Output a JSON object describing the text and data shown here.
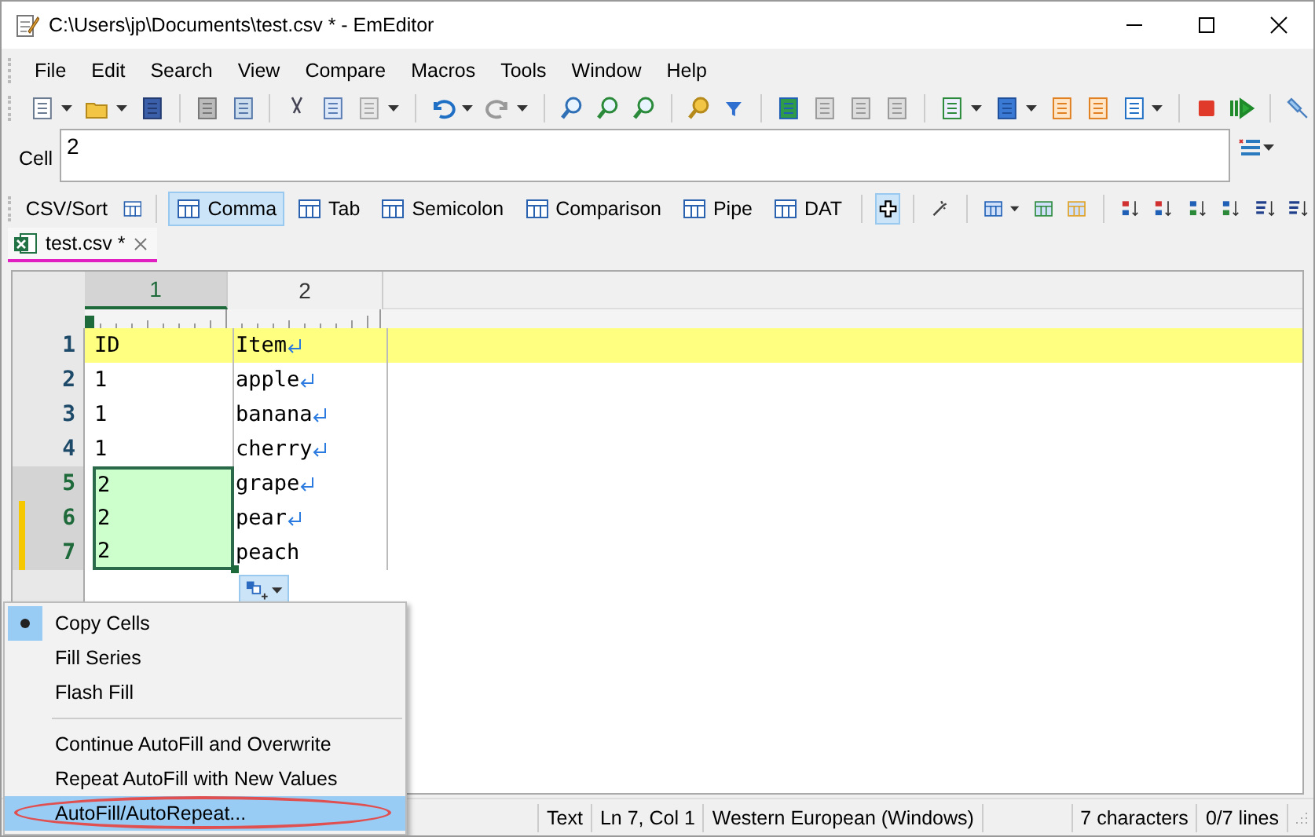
{
  "window": {
    "title": "C:\\Users\\jp\\Documents\\test.csv * - EmEditor"
  },
  "menu_bar": [
    "File",
    "Edit",
    "Search",
    "View",
    "Compare",
    "Macros",
    "Tools",
    "Window",
    "Help"
  ],
  "cell_bar": {
    "label": "Cell",
    "value": "2"
  },
  "csv_bar": {
    "label": "CSV/Sort",
    "formats": [
      {
        "label": "Comma",
        "selected": true
      },
      {
        "label": "Tab",
        "selected": false
      },
      {
        "label": "Semicolon",
        "selected": false
      },
      {
        "label": "Comparison",
        "selected": false
      },
      {
        "label": "Pipe",
        "selected": false
      },
      {
        "label": "DAT",
        "selected": false
      }
    ]
  },
  "tabs": [
    {
      "label": "test.csv *",
      "selected": true
    }
  ],
  "grid": {
    "columns": [
      {
        "label": "1",
        "selected": true
      },
      {
        "label": "2",
        "selected": false
      }
    ],
    "rows": [
      {
        "number": "1",
        "cells": [
          "ID",
          "Item"
        ],
        "header": true,
        "selected": false,
        "modified": false,
        "newline": true
      },
      {
        "number": "2",
        "cells": [
          "1",
          "apple"
        ],
        "header": false,
        "selected": false,
        "modified": false,
        "newline": true
      },
      {
        "number": "3",
        "cells": [
          "1",
          "banana"
        ],
        "header": false,
        "selected": false,
        "modified": false,
        "newline": true
      },
      {
        "number": "4",
        "cells": [
          "1",
          "cherry"
        ],
        "header": false,
        "selected": false,
        "modified": false,
        "newline": true
      },
      {
        "number": "5",
        "cells": [
          "2",
          "grape"
        ],
        "header": false,
        "selected": true,
        "modified": false,
        "newline": true
      },
      {
        "number": "6",
        "cells": [
          "2",
          "pear"
        ],
        "header": false,
        "selected": true,
        "modified": true,
        "newline": true
      },
      {
        "number": "7",
        "cells": [
          "2",
          "peach"
        ],
        "header": false,
        "selected": true,
        "modified": true,
        "newline": false
      }
    ]
  },
  "autofill_menu": [
    {
      "kind": "item",
      "label": "Copy Cells",
      "selected": true,
      "highlighted": false,
      "circled": false
    },
    {
      "kind": "item",
      "label": "Fill Series",
      "selected": false,
      "highlighted": false,
      "circled": false
    },
    {
      "kind": "item",
      "label": "Flash Fill",
      "selected": false,
      "highlighted": false,
      "circled": false
    },
    {
      "kind": "separator"
    },
    {
      "kind": "item",
      "label": "Continue AutoFill and Overwrite",
      "selected": false,
      "highlighted": false,
      "circled": false
    },
    {
      "kind": "item",
      "label": "Repeat AutoFill with New Values",
      "selected": false,
      "highlighted": false,
      "circled": false
    },
    {
      "kind": "item",
      "label": "AutoFill/AutoRepeat...",
      "selected": false,
      "highlighted": true,
      "circled": true
    }
  ],
  "status_bar": [
    "Text",
    "Ln 7, Col 1",
    "Western European (Windows)",
    "7 characters",
    "0/7 lines"
  ]
}
